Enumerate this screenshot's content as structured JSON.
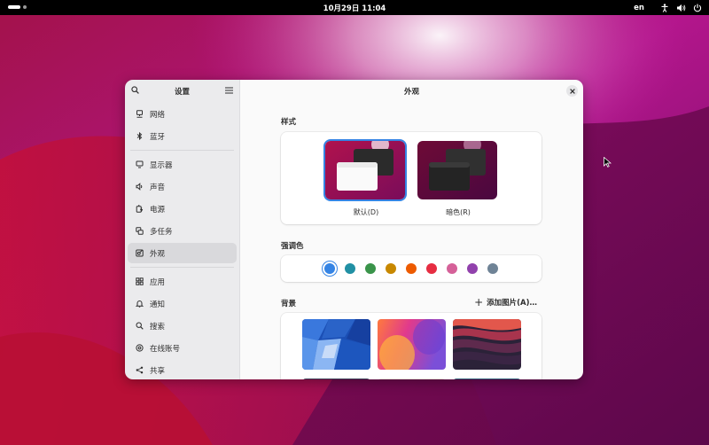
{
  "topbar": {
    "clock": "10月29日  11:04",
    "lang": "en",
    "tray_icons": [
      "accessibility-icon",
      "volume-icon",
      "power-icon"
    ]
  },
  "settings": {
    "sidebar_title": "设置",
    "items": [
      {
        "label": "网络",
        "icon": "network-icon"
      },
      {
        "label": "蓝牙",
        "icon": "bluetooth-icon"
      },
      {
        "label": "显示器",
        "icon": "display-icon"
      },
      {
        "label": "声音",
        "icon": "sound-icon"
      },
      {
        "label": "电源",
        "icon": "power-icon"
      },
      {
        "label": "多任务",
        "icon": "multitasking-icon"
      },
      {
        "label": "外观",
        "icon": "appearance-icon",
        "active": true
      },
      {
        "label": "应用",
        "icon": "apps-icon"
      },
      {
        "label": "通知",
        "icon": "bell-icon"
      },
      {
        "label": "搜索",
        "icon": "search-icon"
      },
      {
        "label": "在线账号",
        "icon": "at-icon"
      },
      {
        "label": "共享",
        "icon": "share-icon"
      }
    ],
    "page_title": "外观",
    "style": {
      "label": "样式",
      "options": [
        {
          "caption": "默认(D)",
          "variant": "light",
          "selected": true
        },
        {
          "caption": "暗色(R)",
          "variant": "dark",
          "selected": false
        }
      ]
    },
    "accent": {
      "label": "强调色",
      "colors": [
        "#3584e4",
        "#2190a4",
        "#3a944a",
        "#c88800",
        "#ed5b00",
        "#e62d42",
        "#d56199",
        "#9141ac",
        "#6f8396"
      ],
      "selected_index": 0
    },
    "background": {
      "label": "背景",
      "add_label": "添加图片(A)…",
      "thumbnails": [
        "blue-blocks",
        "orange-purple-gradient",
        "dark-waves"
      ]
    }
  },
  "colors": {
    "accent": "#3584e4"
  }
}
